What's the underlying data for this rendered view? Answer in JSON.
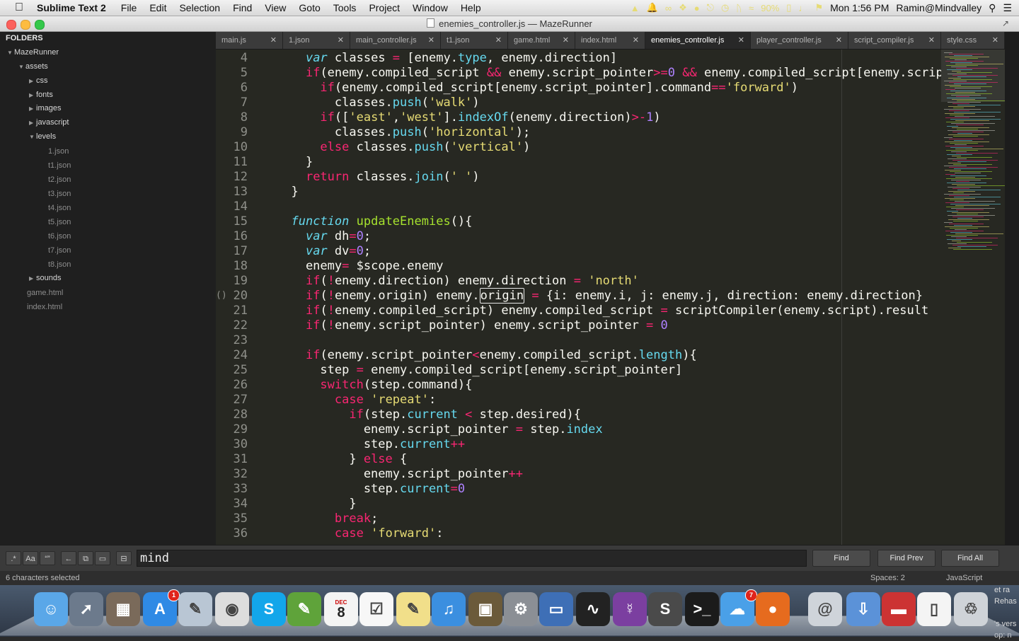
{
  "menubar": {
    "app_name": "Sublime Text 2",
    "items": [
      "File",
      "Edit",
      "Selection",
      "Find",
      "View",
      "Goto",
      "Tools",
      "Project",
      "Window",
      "Help"
    ],
    "battery": "90%",
    "datetime": "Mon 1:56 PM",
    "user": "Ramin@Mindvalley"
  },
  "window": {
    "title": "enemies_controller.js — MazeRunner"
  },
  "sidebar": {
    "header": "FOLDERS",
    "root": "MazeRunner",
    "assets": "assets",
    "folders": [
      "css",
      "fonts",
      "images",
      "javascript",
      "levels"
    ],
    "levels_files": [
      "1.json",
      "t1.json",
      "t2.json",
      "t3.json",
      "t4.json",
      "t5.json",
      "t6.json",
      "t7.json",
      "t8.json"
    ],
    "sounds": "sounds",
    "root_files": [
      "game.html",
      "index.html"
    ]
  },
  "tabs": [
    {
      "label": "main.js"
    },
    {
      "label": "1.json"
    },
    {
      "label": "main_controller.js"
    },
    {
      "label": "t1.json"
    },
    {
      "label": "game.html"
    },
    {
      "label": "index.html"
    },
    {
      "label": "enemies_controller.js",
      "active": true
    },
    {
      "label": "player_controller.js"
    },
    {
      "label": "script_compiler.js"
    },
    {
      "label": "style.css"
    }
  ],
  "editor": {
    "line_numbers": [
      "4",
      "5",
      "6",
      "7",
      "8",
      "9",
      "10",
      "11",
      "12",
      "13",
      "14",
      "15",
      "16",
      "17",
      "18",
      "19",
      "20",
      "21",
      "22",
      "23",
      "24",
      "25",
      "26",
      "27",
      "28",
      "29",
      "30",
      "31",
      "32",
      "33",
      "34",
      "35",
      "36"
    ],
    "current_line_marker": "()",
    "lines": [
      "    var classes = [enemy.type, enemy.direction]",
      "    if(enemy.compiled_script && enemy.script_pointer>=0 && enemy.compiled_script[enemy.script_",
      "      if(enemy.compiled_script[enemy.script_pointer].command=='forward')",
      "        classes.push('walk')",
      "      if(['east','west'].indexOf(enemy.direction)>-1)",
      "        classes.push('horizontal');",
      "      else classes.push('vertical')",
      "    }",
      "    return classes.join(' ')",
      "  }",
      "",
      "  function updateEnemies(){",
      "    var dh=0;",
      "    var dv=0;",
      "    enemy= $scope.enemy",
      "    if(!enemy.direction) enemy.direction = 'north'",
      "    if(!enemy.origin) enemy.origin = {i: enemy.i, j: enemy.j, direction: enemy.direction}",
      "    if(!enemy.compiled_script) enemy.compiled_script = scriptCompiler(enemy.script).result",
      "    if(!enemy.script_pointer) enemy.script_pointer = 0",
      "",
      "    if(enemy.script_pointer<enemy.compiled_script.length){",
      "      step = enemy.compiled_script[enemy.script_pointer]",
      "      switch(step.command){",
      "        case 'repeat':",
      "          if(step.current < step.desired){",
      "            enemy.script_pointer = step.index",
      "            step.current++",
      "          } else {",
      "            enemy.script_pointer++",
      "            step.current=0",
      "          }",
      "        break;",
      "        case 'forward':"
    ]
  },
  "find_panel": {
    "query": "mind",
    "option_icons": [
      ".*",
      "Aa",
      "“”",
      "←",
      "⧉",
      "▭",
      "⊟"
    ],
    "find_label": "Find",
    "find_prev_label": "Find Prev",
    "find_all_label": "Find All"
  },
  "statusbar": {
    "selection": "6 characters selected",
    "indentation": "Spaces: 2",
    "syntax": "JavaScript"
  },
  "dock": {
    "calendar_month": "DEC",
    "calendar_day": "8",
    "appstore_badge": "1",
    "mail_badge": "7",
    "desktop_text": "et ra\nRehas\n\n's vers\nop: n",
    "apps": [
      "finder-icon",
      "launchpad-icon",
      "photo-browser-icon",
      "app-store-icon",
      "preview-icon",
      "chrome-icon",
      "skype-icon",
      "evernote-icon",
      "calendar-icon",
      "reminders-icon",
      "stickies-icon",
      "itunes-icon",
      "iphoto-icon",
      "system-preferences-icon",
      "keynote-icon",
      "activity-monitor-icon",
      "github-icon",
      "sublime-icon",
      "terminal-icon",
      "messages-icon",
      "firefox-icon",
      "mail-icon",
      "downloads-icon",
      "document-icon",
      "file-icon",
      "trash-icon"
    ]
  }
}
